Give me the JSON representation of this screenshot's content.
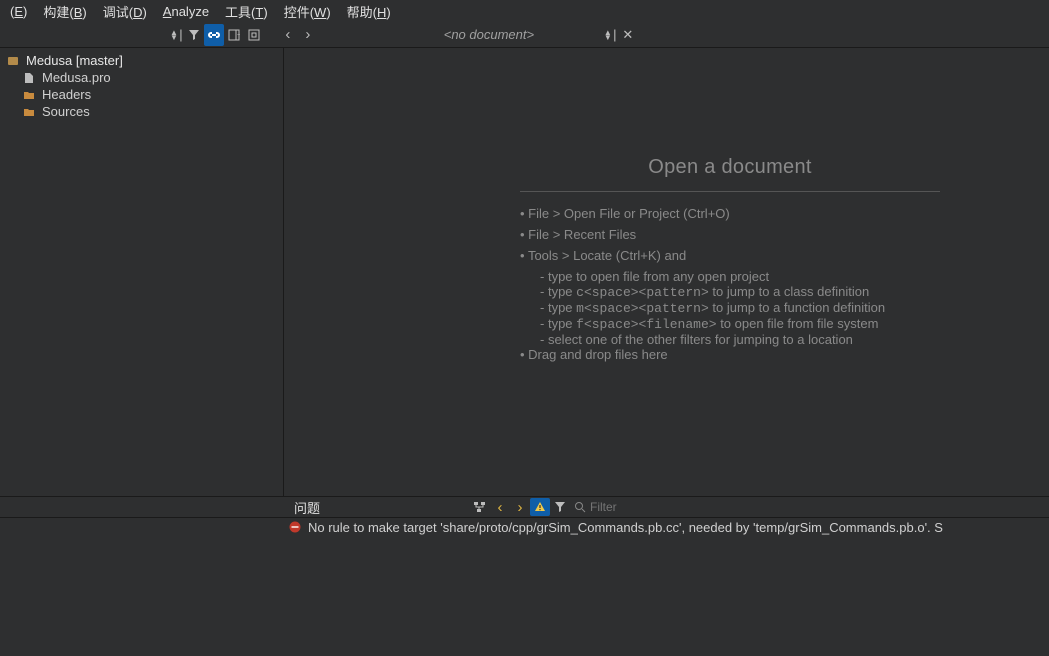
{
  "menu": {
    "edit_pre": "(",
    "edit_u": "E",
    "edit_post": ")",
    "build": "构建(",
    "build_u": "B",
    "build_post": ")",
    "debug": "调试(",
    "debug_u": "D",
    "debug_post": ")",
    "analyze_u": "A",
    "analyze_post": "nalyze",
    "tools": "工具(",
    "tools_u": "T",
    "tools_post": ")",
    "widgets": "控件(",
    "widgets_u": "W",
    "widgets_post": ")",
    "help": "帮助(",
    "help_u": "H",
    "help_post": ")"
  },
  "toolbar": {
    "doc_label": "<no document>"
  },
  "tree": {
    "root": "Medusa [master]",
    "items": [
      {
        "label": "Medusa.pro"
      },
      {
        "label": "Headers"
      },
      {
        "label": "Sources"
      }
    ]
  },
  "welcome": {
    "title": "Open a document",
    "items": [
      "File > Open File or Project (Ctrl+O)",
      "File > Recent Files",
      "Tools > Locate (Ctrl+K) and",
      "Drag and drop files here"
    ],
    "sub": {
      "a_pre": "type to open file from any open project",
      "b_pre": "type ",
      "b_code": "c<space><pattern>",
      "b_post": " to jump to a class definition",
      "c_pre": "type ",
      "c_code": "m<space><pattern>",
      "c_post": " to jump to a function definition",
      "d_pre": "type ",
      "d_code": "f<space><filename>",
      "d_post": " to open file from file system",
      "e": "select one of the other filters for jumping to a location"
    }
  },
  "issues": {
    "tab": "问题",
    "filter_placeholder": "Filter",
    "error": "No rule to make target 'share/proto/cpp/grSim_Commands.pb.cc', needed by 'temp/grSim_Commands.pb.o'.  S"
  }
}
